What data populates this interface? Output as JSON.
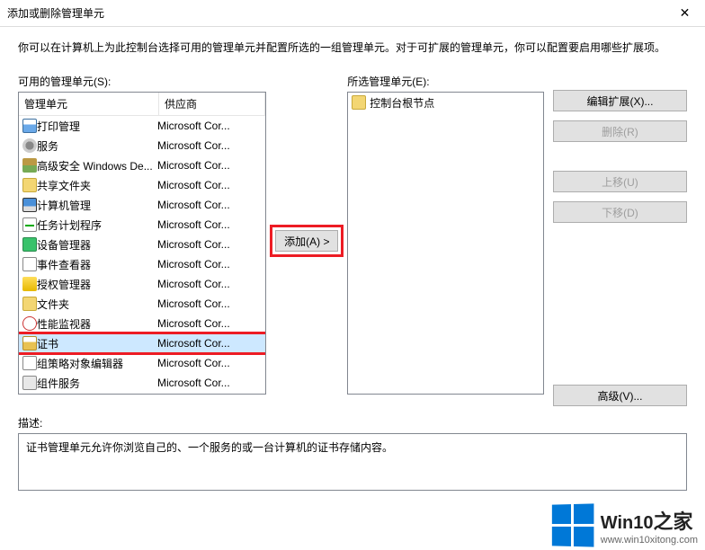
{
  "window": {
    "title": "添加或删除管理单元",
    "close": "✕"
  },
  "intro": "你可以在计算机上为此控制台选择可用的管理单元并配置所选的一组管理单元。对于可扩展的管理单元，你可以配置要启用哪些扩展项。",
  "available": {
    "label": "可用的管理单元(S):",
    "headers": {
      "name": "管理单元",
      "vendor": "供应商"
    },
    "items": [
      {
        "icon": "ic-printer",
        "name": "打印管理",
        "vendor": "Microsoft Cor..."
      },
      {
        "icon": "ic-gear",
        "name": "服务",
        "vendor": "Microsoft Cor..."
      },
      {
        "icon": "ic-wall",
        "name": "高级安全 Windows De...",
        "vendor": "Microsoft Cor..."
      },
      {
        "icon": "ic-folder",
        "name": "共享文件夹",
        "vendor": "Microsoft Cor..."
      },
      {
        "icon": "ic-pc",
        "name": "计算机管理",
        "vendor": "Microsoft Cor..."
      },
      {
        "icon": "ic-task",
        "name": "任务计划程序",
        "vendor": "Microsoft Cor..."
      },
      {
        "icon": "ic-dev",
        "name": "设备管理器",
        "vendor": "Microsoft Cor..."
      },
      {
        "icon": "ic-event",
        "name": "事件查看器",
        "vendor": "Microsoft Cor..."
      },
      {
        "icon": "ic-auth",
        "name": "授权管理器",
        "vendor": "Microsoft Cor..."
      },
      {
        "icon": "ic-folder",
        "name": "文件夹",
        "vendor": "Microsoft Cor..."
      },
      {
        "icon": "ic-perf",
        "name": "性能监视器",
        "vendor": "Microsoft Cor..."
      },
      {
        "icon": "ic-cert",
        "name": "证书",
        "vendor": "Microsoft Cor...",
        "selected": true
      },
      {
        "icon": "ic-gp",
        "name": "组策略对象编辑器",
        "vendor": "Microsoft Cor..."
      },
      {
        "icon": "ic-comp",
        "name": "组件服务",
        "vendor": "Microsoft Cor..."
      }
    ]
  },
  "selected": {
    "label": "所选管理单元(E):",
    "root": {
      "icon": "ic-console",
      "name": "控制台根节点"
    }
  },
  "buttons": {
    "add": "添加(A) >",
    "editExt": "编辑扩展(X)...",
    "remove": "删除(R)",
    "moveUp": "上移(U)",
    "moveDown": "下移(D)",
    "advanced": "高级(V)..."
  },
  "description": {
    "label": "描述:",
    "text": "证书管理单元允许你浏览自己的、一个服务的或一台计算机的证书存储内容。"
  },
  "watermark": {
    "brand": "Win10",
    "suffix": "之家",
    "url": "www.win10xitong.com"
  }
}
